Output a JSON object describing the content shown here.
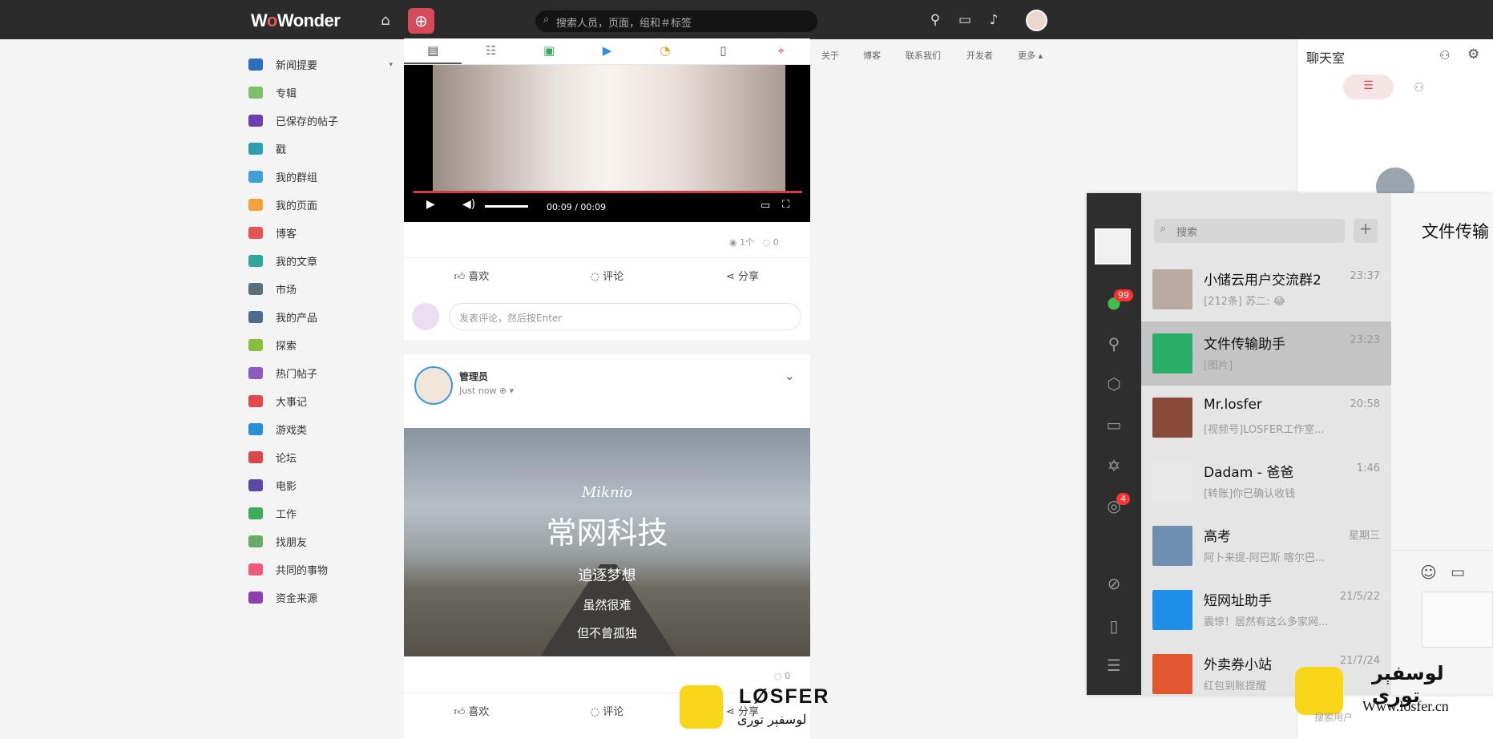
{
  "topbar": {
    "logo": "WoWonder",
    "search_placeholder": "搜索人员，页面，组和＃标签"
  },
  "sidebar": {
    "items": [
      {
        "label": "新闻提要",
        "color": "#2d6fbd"
      },
      {
        "label": "专辑",
        "color": "#7cc06a"
      },
      {
        "label": "已保存的帖子",
        "color": "#6a3fb0"
      },
      {
        "label": "戳",
        "color": "#2f9fb0"
      },
      {
        "label": "我的群组",
        "color": "#3fa0d8"
      },
      {
        "label": "我的页面",
        "color": "#f2a23a"
      },
      {
        "label": "博客",
        "color": "#e35656"
      },
      {
        "label": "我的文章",
        "color": "#2ea79a"
      },
      {
        "label": "市场",
        "color": "#5b6f7a"
      },
      {
        "label": "我的产品",
        "color": "#4d6a8f"
      },
      {
        "label": "探索",
        "color": "#86c03a"
      },
      {
        "label": "热门帖子",
        "color": "#8b5bc3"
      },
      {
        "label": "大事记",
        "color": "#e2474b"
      },
      {
        "label": "游戏类",
        "color": "#2b8ed6"
      },
      {
        "label": "论坛",
        "color": "#d84a4a"
      },
      {
        "label": "电影",
        "color": "#5b48a6"
      },
      {
        "label": "工作",
        "color": "#3dad5b"
      },
      {
        "label": "找朋友",
        "color": "#6aaa68"
      },
      {
        "label": "共同的事物",
        "color": "#ef5a7a"
      },
      {
        "label": "资金来源",
        "color": "#8b3fb0"
      }
    ]
  },
  "top_links": [
    "关于",
    "博客",
    "联系我们",
    "开发者",
    "更多"
  ],
  "video": {
    "time": "00:09 / 00:09"
  },
  "post1": {
    "views": "1个",
    "comments": "0"
  },
  "actions": {
    "like": "喜欢",
    "comment": "评论",
    "share": "分享"
  },
  "comment_placeholder": "发表评论，然后按Enter",
  "post2": {
    "author": "管理员",
    "time": "Just now",
    "banner_brand": "Miknio",
    "banner_title": "常网科技",
    "banner_line1": "追逐梦想",
    "banner_line2": "虽然很难",
    "banner_line3": "但不曾孤独",
    "comments": "0"
  },
  "chat": {
    "title": "聊天室",
    "search_users": "搜索用户"
  },
  "wechat": {
    "search_placeholder": "搜索",
    "nav_badges": {
      "chat": "99",
      "moments": "4"
    },
    "right_title": "文件传输",
    "conversations": [
      {
        "name": "小储云用户交流群2",
        "time": "23:37",
        "msg": "[212条] 苏二: 😂"
      },
      {
        "name": "文件传输助手",
        "time": "23:23",
        "msg": "[图片]"
      },
      {
        "name": "Mr.losfer",
        "time": "20:58",
        "msg": "[视频号]LOSFER工作室..."
      },
      {
        "name": "Dadam - 爸爸",
        "time": "1:46",
        "msg": "[转账]你已确认收钱"
      },
      {
        "name": "高考",
        "time": "星期三",
        "msg": "阿卜来提-阿巴斯 喀尔巴..."
      },
      {
        "name": "短网址助手",
        "time": "21/5/22",
        "msg": "震惊！居然有这么多家网..."
      },
      {
        "name": "外卖券小站",
        "time": "21/7/24",
        "msg": "红包到账提醒"
      }
    ]
  },
  "watermark": {
    "brand": "LØSFER",
    "arabic": "لوسفېر تورى",
    "site": "Www.losfer.cn"
  }
}
